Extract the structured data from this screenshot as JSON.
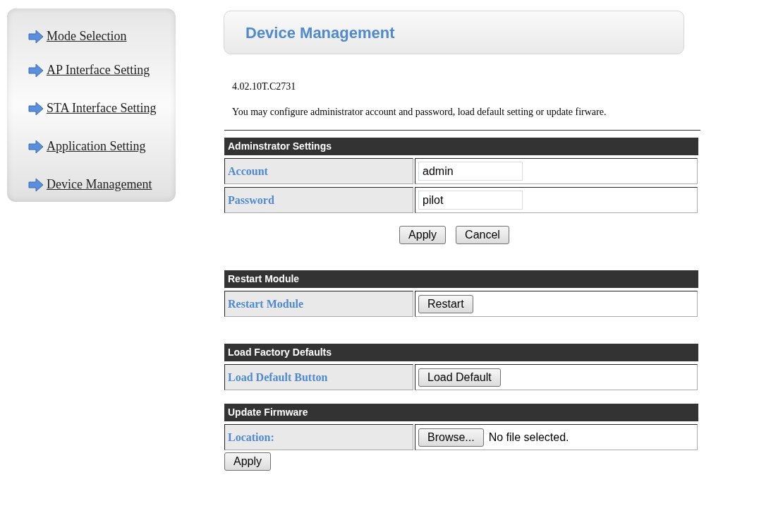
{
  "sidebar": {
    "items": [
      {
        "label": "Mode Selection"
      },
      {
        "label": "AP Interface Setting"
      },
      {
        "label": "STA Interface Setting"
      },
      {
        "label": "Application Setting"
      },
      {
        "label": "Device Management"
      }
    ]
  },
  "header": {
    "title": "Device Management"
  },
  "version": "4.02.10T.C2731",
  "description": "You may configure administrator account and password, load default setting or update firware.",
  "sections": [
    {
      "title": "Adminstrator Settings",
      "rows": [
        {
          "kind": "input",
          "label": "Account",
          "value": "admin"
        },
        {
          "kind": "input",
          "label": "Password",
          "value": "pilot"
        }
      ],
      "buttons": [
        "Apply",
        "Cancel"
      ]
    },
    {
      "title": "Restart Module",
      "rows": [
        {
          "kind": "button",
          "label": "Restart Module",
          "button": "Restart"
        }
      ]
    },
    {
      "title": "Load Factory Defaults",
      "rows": [
        {
          "kind": "button",
          "label": "Load Default Button",
          "button": "Load Default"
        }
      ]
    },
    {
      "title": "Update Firmware",
      "rows": [
        {
          "kind": "file",
          "label": "Location:",
          "button": "Browse...",
          "status": "No file selected."
        }
      ],
      "buttons": [
        "Apply"
      ]
    }
  ]
}
